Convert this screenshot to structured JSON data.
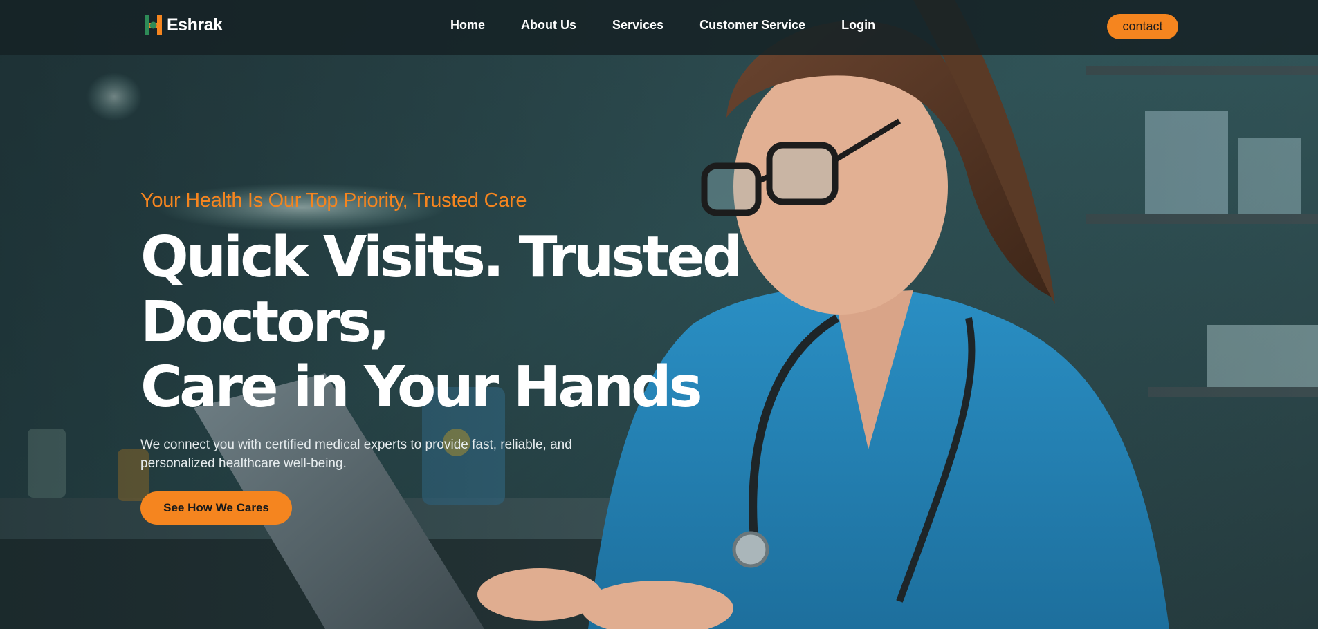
{
  "brand": {
    "name": "Eshrak",
    "colors": {
      "orange": "#f5851f",
      "green": "#2e8b57"
    }
  },
  "nav": {
    "items": [
      "Home",
      "About Us",
      "Services",
      "Customer Service",
      "Login"
    ],
    "contact_label": "contact"
  },
  "hero": {
    "tagline": "Your Health Is Our Top Priority, Trusted Care",
    "headline_line1": "Quick Visits. Trusted Doctors,",
    "headline_line2": "Care in Your Hands",
    "description_line1": "We connect you with certified medical experts to provide fast, reliable, and",
    "description_line2": "personalized healthcare well-being.",
    "cta_label": "See How We Cares",
    "image_subject": "doctor-working-on-laptop"
  },
  "theme": {
    "accent": "#f5851f",
    "navbar_bg": "#162226",
    "text": "#ffffff"
  }
}
